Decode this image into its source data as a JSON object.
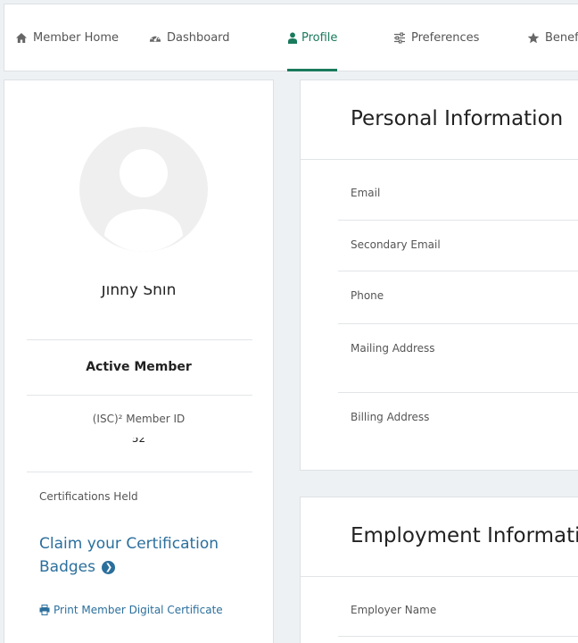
{
  "nav": {
    "items": [
      {
        "label": "Member Home",
        "icon": "home-icon"
      },
      {
        "label": "Dashboard",
        "icon": "dashboard-icon"
      },
      {
        "label": "Profile",
        "icon": "user-icon",
        "active": true
      },
      {
        "label": "Preferences",
        "icon": "sliders-icon"
      },
      {
        "label": "Benefi",
        "icon": "star-icon"
      }
    ]
  },
  "profile": {
    "name": "Jinny Shin",
    "status": "Active Member",
    "member_id_label": "(ISC)² Member ID",
    "member_id_value": "52",
    "certifications_label": "Certifications Held",
    "badge_link": "Claim your Certification Badges",
    "print_link": "Print Member Digital Certificate"
  },
  "personal": {
    "title": "Personal Information",
    "fields": [
      "Email",
      "Secondary Email",
      "Phone",
      "Mailing Address",
      "Billing Address"
    ]
  },
  "employment": {
    "title": "Employment Informatio",
    "fields": [
      "Employer Name"
    ]
  },
  "colors": {
    "accent": "#1a7a5c",
    "link": "#2b6f9c"
  }
}
